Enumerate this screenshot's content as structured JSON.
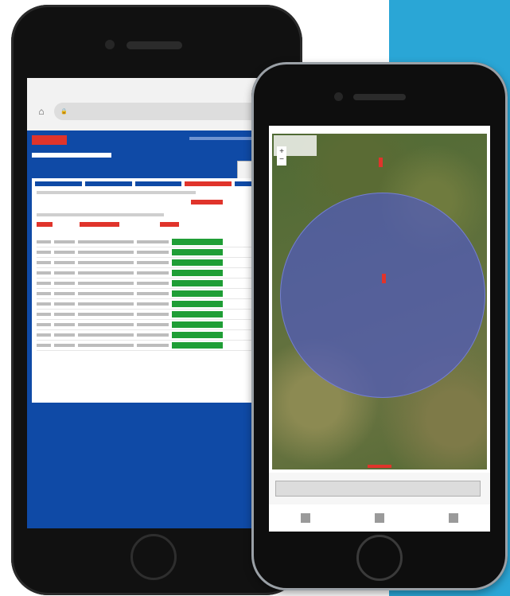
{
  "background": {
    "accent_panel_color": "#2aa6d6"
  },
  "back_phone": {
    "status_left": "",
    "status_right": "",
    "url_text": "",
    "site_logo_text": "",
    "colors": {
      "primary": "#0f4aa6",
      "alert": "#e0342b",
      "ok": "#1f9e36"
    },
    "table_rows": 11
  },
  "front_phone": {
    "status_right": "",
    "map_legend_text": "",
    "zoom_in": "+",
    "zoom_out": "−",
    "circle_color": "#505abe"
  }
}
